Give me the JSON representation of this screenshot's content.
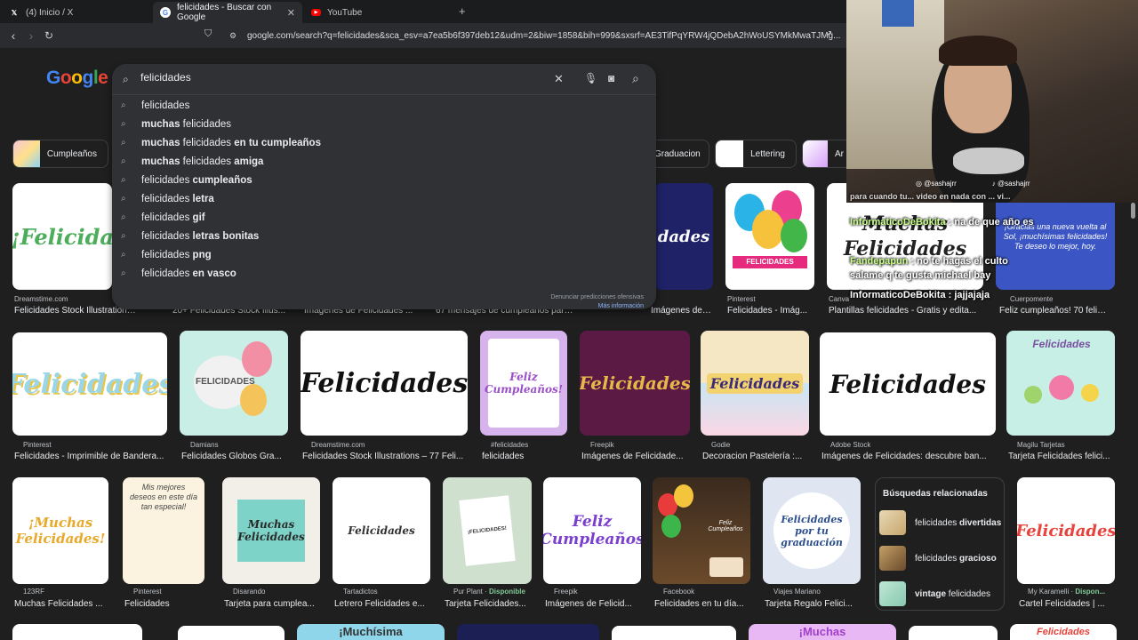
{
  "tabs": [
    {
      "label": "(4) Inicio / X",
      "icon": "x-logo-icon"
    },
    {
      "label": "felicidades - Buscar con Google",
      "icon": "google-icon"
    },
    {
      "label": "YouTube",
      "icon": "youtube-icon"
    }
  ],
  "url": "google.com/search?q=felicidades&sca_esv=a7ea5b6f397deb12&udm=2&biw=1858&bih=999&sxsrf=AE3TifPqYRW4jQDebA2hWoUSYMkMwaTJMg...",
  "logo": "Google",
  "search": {
    "value": "felicidades",
    "suggestions": [
      {
        "pre": "",
        "base": "felicidades",
        "post": ""
      },
      {
        "pre": "muchas",
        "base": " felicidades",
        "post": ""
      },
      {
        "pre": "muchas",
        "base": " felicidades",
        "post": " en tu cumpleaños"
      },
      {
        "pre": "muchas",
        "base": " felicidades",
        "post": " amiga"
      },
      {
        "pre": "",
        "base": "felicidades",
        "post": " cumpleaños"
      },
      {
        "pre": "",
        "base": "felicidades",
        "post": " letra"
      },
      {
        "pre": "",
        "base": "felicidades",
        "post": " gif"
      },
      {
        "pre": "",
        "base": "felicidades",
        "post": " letras bonitas"
      },
      {
        "pre": "",
        "base": "felicidades",
        "post": " png"
      },
      {
        "pre": "",
        "base": "felicidades",
        "post": " en vasco"
      }
    ],
    "report": "Denunciar predicciones ofensivas",
    "more_info": "Más información"
  },
  "chips": [
    {
      "label": "Cumpleaños"
    },
    {
      "label": "Graduacion"
    },
    {
      "label": "Lettering"
    },
    {
      "label": "Ar"
    }
  ],
  "row1": [
    {
      "source": "Dreamstime.com",
      "title": "Felicidades Stock Illustrations ...",
      "text": "¡Felicida"
    },
    {
      "source": "",
      "title": "20+ Felicidades Stock Illus...",
      "text": ""
    },
    {
      "source": "",
      "title": "Imágenes de Felicidades ...",
      "text": ""
    },
    {
      "source": "",
      "title": "67 mensajes de cumpleaños para ...",
      "text": ""
    },
    {
      "source": "",
      "title": "Imágenes de \"Muchas Feli...",
      "text": "dades"
    },
    {
      "source": "Pinterest",
      "title": "Felicidades - Imág...",
      "text": "FELICIDADES"
    },
    {
      "source": "Canva",
      "title": "Plantillas felicidades - Gratis y edita...",
      "text": "Muchas Felicidades"
    },
    {
      "source": "Cuerpomente",
      "title": "Feliz cumpleaños! 70 felici...",
      "text": "¡Gracias una nueva vuelta al Sol, ¡muchísimas felicidades! Te deseo lo mejor, hoy."
    }
  ],
  "row2": [
    {
      "source": "Pinterest",
      "title": "Felicidades - Imprimible de Bandera...",
      "text": "Felicidades"
    },
    {
      "source": "Damians",
      "title": "Felicidades Globos Gra...",
      "text": "FELICIDADES"
    },
    {
      "source": "Dreamstime.com",
      "title": "Felicidades Stock Illustrations – 77 Feli...",
      "text": "Felicidades"
    },
    {
      "source": "#felicidades",
      "title": "felicidades",
      "text": "Feliz Cumpleaños!"
    },
    {
      "source": "Freepik",
      "title": "Imágenes de Felicidade...",
      "text": "Felicidades"
    },
    {
      "source": "Godie",
      "title": "Decoracion Pastelería :...",
      "text": "Felicidades"
    },
    {
      "source": "Adobe Stock",
      "title": "Imágenes de Felicidades: descubre ban...",
      "text": "Felicidades"
    },
    {
      "source": "Magilu Tarjetas",
      "title": "Tarjeta Felicidades felici...",
      "text": "Felicidades"
    }
  ],
  "row3": [
    {
      "source": "123RF",
      "title": "Muchas Felicidades ...",
      "text": "¡Muchas Felicidades!"
    },
    {
      "source": "Pinterest",
      "title": "Felicidades",
      "text": "Mis mejores deseos en este día tan especial!"
    },
    {
      "source": "Disarando",
      "title": "Tarjeta para cumplea...",
      "text": "Muchas Felicidades"
    },
    {
      "source": "Tartadictos",
      "title": "Letrero Felicidades e...",
      "text": "Felicidades"
    },
    {
      "source": "Pur Plant",
      "available": "Disponible",
      "title": "Tarjeta Felicidades...",
      "text": "¡FELICIDADES!"
    },
    {
      "source": "Freepik",
      "title": "Imágenes de Felicid...",
      "text": "Feliz Cumpleaños"
    },
    {
      "source": "Facebook",
      "title": "Felicidades en tu día...",
      "text": "Feliz Cumpleaños"
    },
    {
      "source": "Viajes Mariano",
      "title": "Tarjeta Regalo Felici...",
      "text": "Felicidades por tu graduación"
    },
    {
      "source": "My Karamelli",
      "available": "Dispon...",
      "title": "Cartel Felicidades | ...",
      "text": "Felicidades"
    }
  ],
  "row4": [
    {
      "text": ""
    },
    {
      "text": ""
    },
    {
      "text": "¡Muchísima"
    },
    {
      "text": ""
    },
    {
      "text": ""
    },
    {
      "text": "¡Muchas"
    },
    {
      "text": ""
    },
    {
      "text": "Felicidades"
    }
  ],
  "related": {
    "heading": "Búsquedas relacionadas",
    "items": [
      {
        "base": "felicidades ",
        "bold": "divertidas"
      },
      {
        "base": "felicidades ",
        "bold": "gracioso"
      },
      {
        "bold": "vintage",
        "base": " felicidades"
      }
    ]
  },
  "stream": {
    "handle1": "@sashajrr",
    "handle2": "@sashajrr",
    "chat": [
      {
        "user": "InformaticoDeBokita",
        "msg": "na de que año es"
      },
      {
        "user": "Fandepapun",
        "msg": "no te hagas el culto salame q te gusta michael bay"
      },
      {
        "user": "InformaticoDeBokita",
        "msg": "jajjajaja"
      }
    ],
    "pre_chat": "para cuando tu... video en nada con ... vi..."
  },
  "colors": {
    "bg": "#1f1f1f",
    "panel": "#303134",
    "link": "#8ab4f8"
  }
}
